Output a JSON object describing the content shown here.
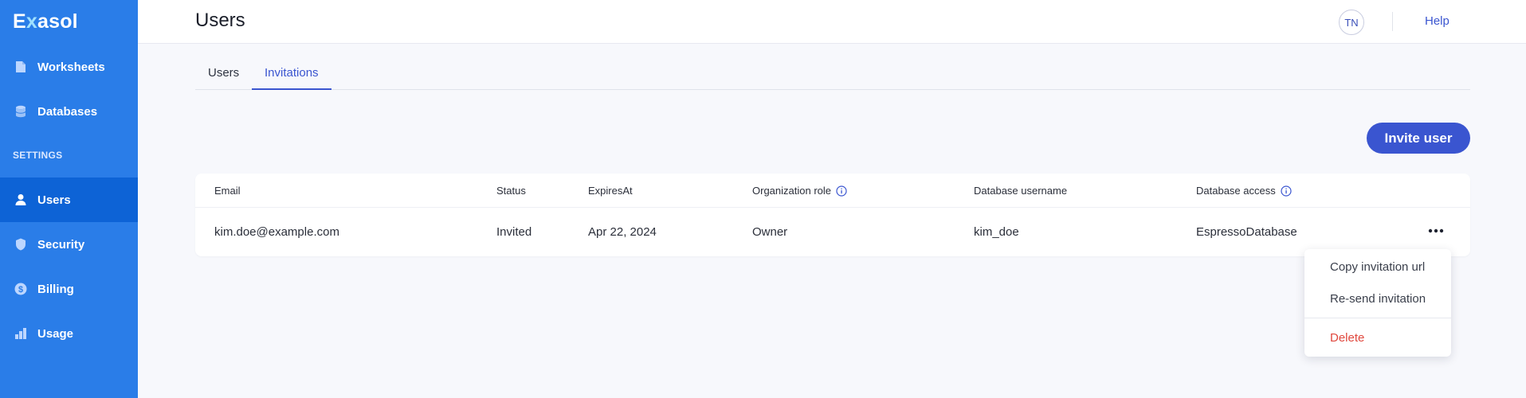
{
  "app": {
    "logo_prefix": "E",
    "logo_x": "x",
    "logo_suffix": "asol"
  },
  "sidebar": {
    "items": [
      {
        "label": "Worksheets",
        "icon": "file-icon"
      },
      {
        "label": "Databases",
        "icon": "database-icon"
      }
    ],
    "section_label": "SETTINGS",
    "settings_items": [
      {
        "label": "Users",
        "icon": "user-icon",
        "active": true
      },
      {
        "label": "Security",
        "icon": "shield-icon"
      },
      {
        "label": "Billing",
        "icon": "dollar-icon"
      },
      {
        "label": "Usage",
        "icon": "bar-chart-icon"
      }
    ]
  },
  "header": {
    "title": "Users",
    "avatar_initials": "TN",
    "help_label": "Help"
  },
  "tabs": [
    {
      "label": "Users",
      "active": false
    },
    {
      "label": "Invitations",
      "active": true
    }
  ],
  "invite_button_label": "Invite user",
  "table": {
    "columns": [
      "Email",
      "Status",
      "ExpiresAt",
      "Organization role",
      "Database username",
      "Database access"
    ],
    "rows": [
      {
        "email": "kim.doe@example.com",
        "status": "Invited",
        "expires_at": "Apr 22, 2024",
        "role": "Owner",
        "db_username": "kim_doe",
        "db_access": "EspressoDatabase"
      }
    ]
  },
  "row_menu": {
    "items": [
      "Copy invitation url",
      "Re-send invitation"
    ],
    "danger_item": "Delete"
  },
  "colors": {
    "sidebar": "#2a7de8",
    "sidebar_active": "#0d63d6",
    "accent": "#3a55d0",
    "danger": "#e0483e"
  }
}
